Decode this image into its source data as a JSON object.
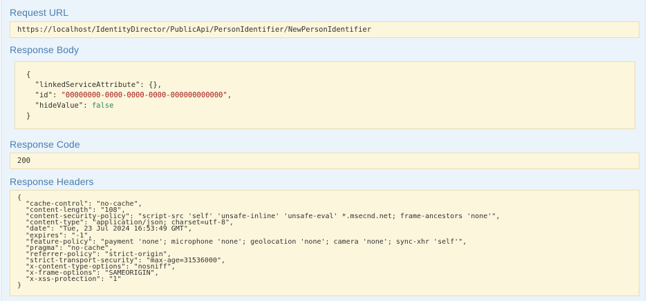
{
  "request_url": {
    "title": "Request URL",
    "value": "https://localhost/IdentityDirector/PublicApi/PersonIdentifier/NewPersonIdentifier"
  },
  "response_body": {
    "title": "Response Body",
    "open_brace": "{",
    "close_brace": "}",
    "lines": [
      {
        "key": "\"linkedServiceAttribute\": ",
        "value": "{},",
        "value_type": "plain"
      },
      {
        "key": "\"id\": ",
        "value": "\"00000000-0000-0000-0000-000000000000\"",
        "suffix": ",",
        "value_type": "string"
      },
      {
        "key": "\"hideValue\": ",
        "value": "false",
        "value_type": "boolean"
      }
    ]
  },
  "response_code": {
    "title": "Response Code",
    "value": "200"
  },
  "response_headers": {
    "title": "Response Headers",
    "open_brace": "{",
    "close_brace": "}",
    "lines": [
      "  \"cache-control\": \"no-cache\",",
      "  \"content-length\": \"108\",",
      "  \"content-security-policy\": \"script-src 'self' 'unsafe-inline' 'unsafe-eval' *.msecnd.net; frame-ancestors 'none'\",",
      "  \"content-type\": \"application/json; charset=utf-8\",",
      "  \"date\": \"Tue, 23 Jul 2024 16:53:49 GMT\",",
      "  \"expires\": \"-1\",",
      "  \"feature-policy\": \"payment 'none'; microphone 'none'; geolocation 'none'; camera 'none'; sync-xhr 'self'\",",
      "  \"pragma\": \"no-cache\",",
      "  \"referrer-policy\": \"strict-origin\",",
      "  \"strict-transport-security\": \"max-age=31536000\",",
      "  \"x-content-type-options\": \"nosniff\",",
      "  \"x-frame-options\": \"SAMEORIGIN\",",
      "  \"x-xss-protection\": \"1\""
    ]
  },
  "colors": {
    "heading": "#4a7fae",
    "panel_background": "#ebf3fb",
    "code_background": "#fcf6dc",
    "string_value": "#a31515",
    "boolean_value": "#2e8b57"
  }
}
